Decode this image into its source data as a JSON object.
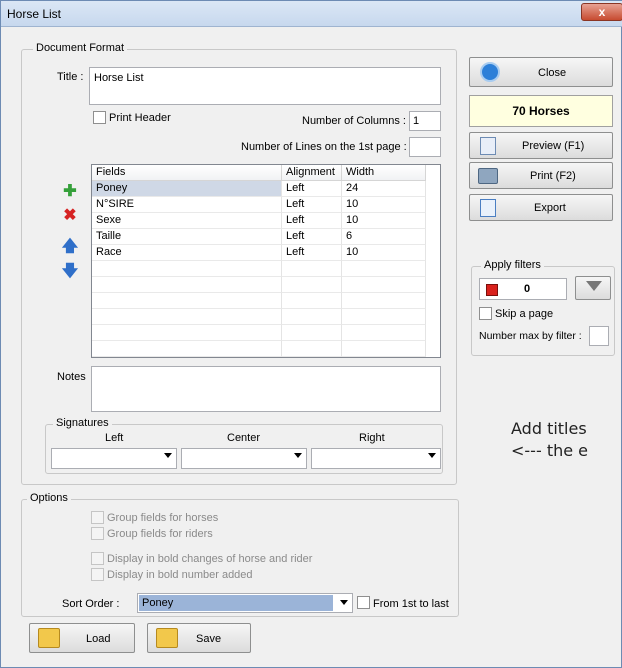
{
  "window": {
    "title": "Horse List",
    "close_glyph": "x"
  },
  "document_format": {
    "legend": "Document Format",
    "title_label": "Title :",
    "title_value": "Horse List",
    "print_header_label": "Print Header",
    "num_columns_label": "Number of Columns :",
    "num_columns_value": "1",
    "num_lines_label": "Number of Lines on the 1st page :",
    "num_lines_value": "",
    "grid": {
      "headers": [
        "Fields",
        "Alignment",
        "Width"
      ],
      "rows": [
        [
          "Poney",
          "Left",
          "24"
        ],
        [
          "N°SIRE",
          "Left",
          "10"
        ],
        [
          "Sexe",
          "Left",
          "10"
        ],
        [
          "Taille",
          "Left",
          "6"
        ],
        [
          "Race",
          "Left",
          "10"
        ]
      ]
    },
    "notes_label": "Notes",
    "signatures": {
      "legend": "Signatures",
      "left": "Left",
      "center": "Center",
      "right": "Right"
    }
  },
  "options": {
    "legend": "Options",
    "group_horses": "Group fields for horses",
    "group_riders": "Group fields for riders",
    "bold_changes": "Display in bold changes of horse and rider",
    "bold_number": "Display in bold number added",
    "sort_order_label": "Sort Order :",
    "sort_order_value": "Poney",
    "from_first_label": "From 1st to last"
  },
  "buttons": {
    "close": "Close",
    "horses_count": "70 Horses",
    "preview": "Preview (F1)",
    "print": "Print (F2)",
    "export": "Export",
    "load": "Load",
    "save": "Save"
  },
  "filters": {
    "legend": "Apply filters",
    "count": "0",
    "skip_page": "Skip a page",
    "max_by_filter": "Number max by filter :"
  },
  "annotation": {
    "line1": "Add titles",
    "line2": "<---  the e"
  },
  "colors": {
    "selection": "#cfd8e6",
    "badge_bg": "#ffffe0",
    "filter_red": "#d9211c",
    "sort_highlight": "#9bb4d8"
  }
}
